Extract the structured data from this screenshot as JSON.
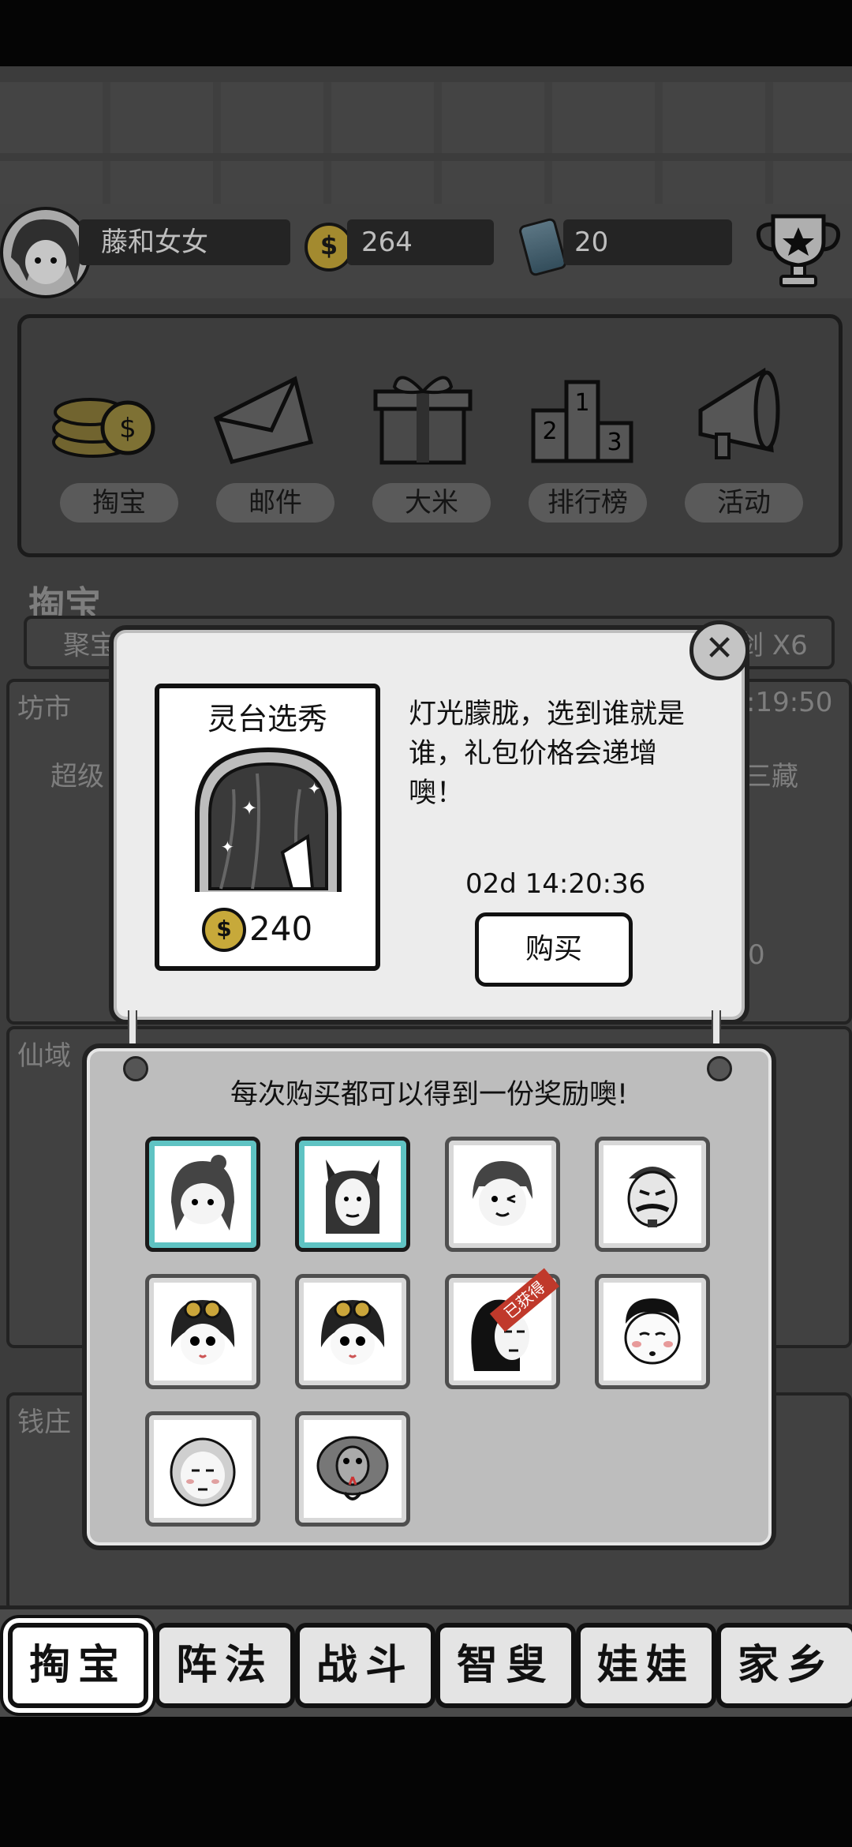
{
  "status": {
    "username": "藤和女女",
    "coins": "264",
    "energy": "20"
  },
  "menu": {
    "items": [
      {
        "label": "掏宝",
        "icon": "coin-stack-icon"
      },
      {
        "label": "邮件",
        "icon": "envelope-icon"
      },
      {
        "label": "大米",
        "icon": "gift-box-icon"
      },
      {
        "label": "排行榜",
        "icon": "podium-icon"
      },
      {
        "label": "活动",
        "icon": "megaphone-icon"
      }
    ]
  },
  "background": {
    "section_title": "掏宝",
    "peek_left": "聚宝",
    "peek_right": "宝剑 X6",
    "market_label": "坊市",
    "market_timer": ":19:50",
    "market_item_left": "超级",
    "market_item_right": "三藏",
    "market_price_right": "0",
    "xianyu_label": "仙域",
    "qianzhuang_label": "钱庄"
  },
  "popup": {
    "item_title": "灵台选秀",
    "item_price": "240",
    "description": "灯光朦胧，选到谁就是谁，礼包价格会递增噢！",
    "timer": "02d 14:20:36",
    "buy_label": "购买",
    "close_label": "✕"
  },
  "rewards": {
    "title": "每次购买都可以得到一份奖励噢!",
    "got_label": "已获得",
    "slots": [
      {
        "name": "reward-girl-hairbun",
        "selected": true
      },
      {
        "name": "reward-woman-catears",
        "selected": true
      },
      {
        "name": "reward-boy-wink",
        "selected": false
      },
      {
        "name": "reward-man-mustache",
        "selected": false
      },
      {
        "name": "reward-girl-goggles-1",
        "selected": false
      },
      {
        "name": "reward-girl-goggles-2",
        "selected": false
      },
      {
        "name": "reward-woman-longhair",
        "selected": false,
        "obtained": true
      },
      {
        "name": "reward-boy-blush",
        "selected": false
      },
      {
        "name": "reward-hooded-face",
        "selected": false
      },
      {
        "name": "reward-cobra",
        "selected": false
      }
    ]
  },
  "tabs": [
    {
      "label": "掏宝",
      "active": true
    },
    {
      "label": "阵法",
      "active": false
    },
    {
      "label": "战斗",
      "active": false
    },
    {
      "label": "智叟",
      "active": false
    },
    {
      "label": "娃娃",
      "active": false
    },
    {
      "label": "家乡",
      "active": false
    }
  ],
  "colors": {
    "accent_teal": "#5fc3c3",
    "coin_gold": "#c7a93a",
    "ribbon_red": "#c0392b"
  }
}
